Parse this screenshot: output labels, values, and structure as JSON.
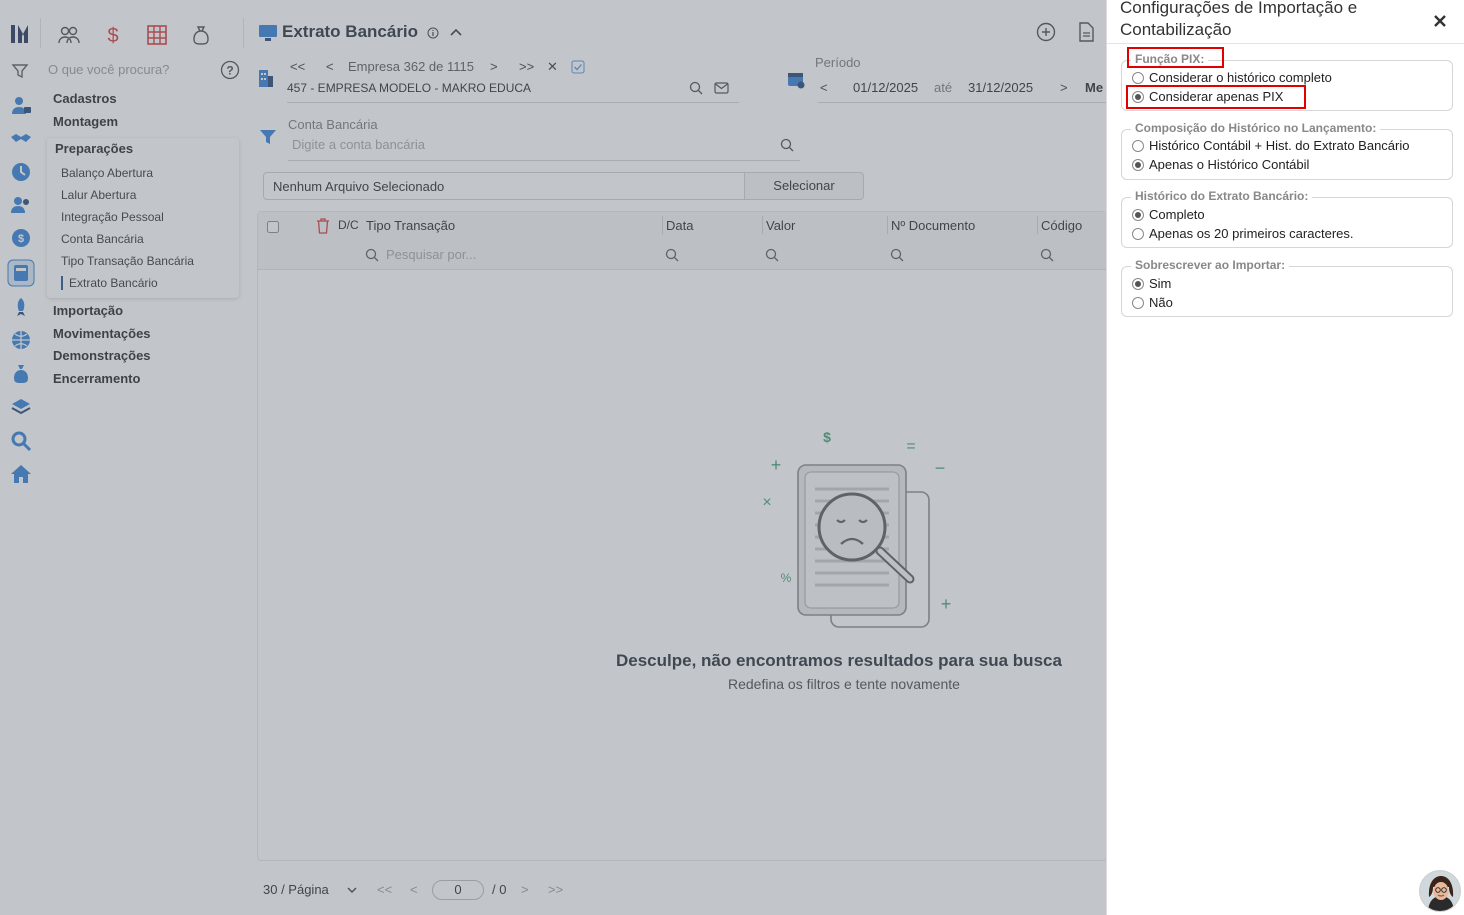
{
  "sidebar": {
    "search_placeholder": "O que você procura?",
    "menu": [
      "Cadastros",
      "Montagem"
    ],
    "submenu_title": "Preparações",
    "submenu_items": [
      "Balanço Abertura",
      "Lalur Abertura",
      "Integração Pessoal",
      "Conta Bancária",
      "Tipo Transação Bancária",
      "Extrato Bancário"
    ],
    "menu_bottom": [
      "Importação",
      "Movimentações",
      "Demonstrações",
      "Encerramento"
    ]
  },
  "header": {
    "title": "Extrato Bancário",
    "pager_first": "<<",
    "pager_prev": "<",
    "pager_text": "Empresa 362 de 1115",
    "pager_next": ">",
    "pager_last": ">>",
    "clear": "✕",
    "company": "457 - EMPRESA MODELO - MAKRO EDUCA",
    "period_label": "Período",
    "date_start": "01/12/2025",
    "date_sep": "até",
    "date_end": "31/12/2025",
    "period_cut": "Me",
    "date_prev": "<",
    "date_next": ">"
  },
  "filter": {
    "label": "Conta Bancária",
    "placeholder": "Digite a conta bancária"
  },
  "file": {
    "value": "Nenhum Arquivo Selecionado",
    "button": "Selecionar"
  },
  "table": {
    "dc": "D/C",
    "columns": [
      "Tipo Transação",
      "Data",
      "Valor",
      "Nº Documento",
      "Código"
    ],
    "search_placeholder": "Pesquisar por...",
    "empty_title": "Desculpe, não encontramos resultados para sua busca",
    "empty_sub": "Redefina os filtros e tente novamente",
    "art_symbols": [
      "$",
      "=",
      "+",
      "−",
      "×",
      "%",
      "+"
    ]
  },
  "footer": {
    "per_page": "30 / Página",
    "page": "0",
    "total": "/ 0",
    "first": "<<",
    "prev": "<",
    "next": ">",
    "last": ">>"
  },
  "panel": {
    "title": "Configurações de Importação e Contabilização",
    "groups": [
      {
        "legend": "Função PIX:",
        "options": [
          "Considerar o histórico completo",
          "Considerar apenas PIX"
        ],
        "selected": 1
      },
      {
        "legend": "Composição do Histórico no Lançamento:",
        "options": [
          "Histórico Contábil + Hist. do Extrato Bancário",
          "Apenas o Histórico Contábil"
        ],
        "selected": 1
      },
      {
        "legend": "Histórico do Extrato Bancário:",
        "options": [
          "Completo",
          "Apenas os 20 primeiros caracteres."
        ],
        "selected": 0
      },
      {
        "legend": "Sobrescrever ao Importar:",
        "options": [
          "Sim",
          "Não"
        ],
        "selected": 0
      }
    ]
  },
  "colors": {
    "accent": "#1a4f8a",
    "highlight": "#e00000",
    "overlay": "#6e7680"
  }
}
